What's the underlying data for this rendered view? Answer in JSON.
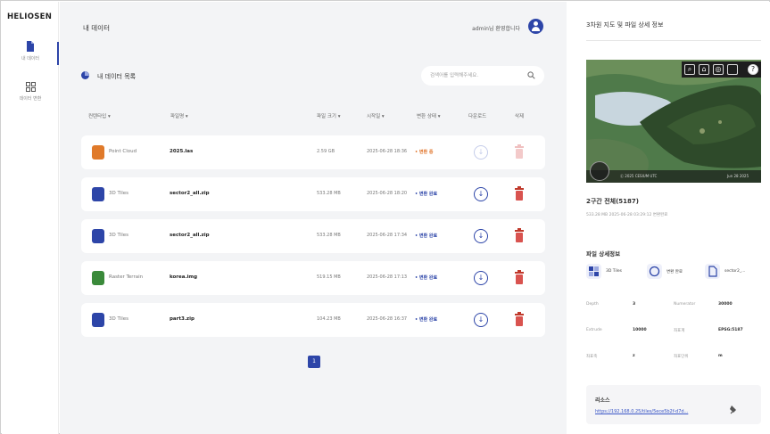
{
  "app": {
    "logo": "HELIOSEN",
    "accent_color": "#2d45a8"
  },
  "sidebar": {
    "items": [
      {
        "label": "내 데이터",
        "icon": "document-icon",
        "active": true
      },
      {
        "label": "데이터 변환",
        "icon": "grid-icon",
        "active": false
      }
    ]
  },
  "header": {
    "title": "내 데이터",
    "greeting": "admin님 환영합니다"
  },
  "list": {
    "title": "내 데이터 목록",
    "search_placeholder": "검색어를 입력해주세요.",
    "columns": [
      "컨텐타입 ▾",
      "파일명 ▾",
      "파일 크기 ▾",
      "시작일 ▾",
      "변환 상태 ▾",
      "다운로드",
      "삭제"
    ],
    "rows": [
      {
        "type": "Point Cloud",
        "type_color": "#e07a2a",
        "name": "2025.las",
        "size": "2.59 GB",
        "date": "2025-06-28 18:36",
        "status": "• 변환 중",
        "status_color": "#e0742a",
        "download_enabled": false
      },
      {
        "type": "3D Tiles",
        "type_color": "#2d45a8",
        "name": "sector2_all.zip",
        "size": "533.28 MB",
        "date": "2025-06-28 18:20",
        "status": "• 변환 완료",
        "status_color": "#2d45a8",
        "download_enabled": true
      },
      {
        "type": "3D Tiles",
        "type_color": "#2d45a8",
        "name": "sector2_all.zip",
        "size": "533.28 MB",
        "date": "2025-06-28 17:34",
        "status": "• 변환 완료",
        "status_color": "#2d45a8",
        "download_enabled": true
      },
      {
        "type": "Raster Terrain",
        "type_color": "#3a8a3a",
        "name": "korea.img",
        "size": "519.15 MB",
        "date": "2025-06-28 17:13",
        "status": "• 변환 완료",
        "status_color": "#2d45a8",
        "download_enabled": true
      },
      {
        "type": "3D Tiles",
        "type_color": "#2d45a8",
        "name": "part3.zip",
        "size": "104.23 MB",
        "date": "2025-06-28 16:37",
        "status": "• 변환 완료",
        "status_color": "#2d45a8",
        "download_enabled": true
      }
    ],
    "page": "1"
  },
  "panel": {
    "title": "3차원 지도 및 파일 상세 정보",
    "map": {
      "controls": [
        "search-icon",
        "home-icon",
        "globe-icon",
        "layers-icon",
        "help-icon"
      ],
      "footer_left": "Ⓒ 2025 CESIUM UTC",
      "footer_date": "Jun 28 2025"
    },
    "file_name": "2구간 전체(5187)",
    "file_meta": "533.28 MB   2025-06-28 03:29:12 변환완료",
    "detail_title": "파일 상세정보",
    "chips": [
      {
        "label": "3D Tiles",
        "icon": "tiles-icon"
      },
      {
        "label": "변환 완료",
        "icon": "circle-icon"
      },
      {
        "label": "sector2_...",
        "icon": "file-icon"
      }
    ],
    "fields": [
      {
        "k1": "Depth",
        "v1": "3",
        "k2": "Numerator",
        "v2": "30000"
      },
      {
        "k1": "Extrude",
        "v1": "10000",
        "k2": "좌표계",
        "v2": "EPSG:5187"
      },
      {
        "k1": "좌표축",
        "v1": "z",
        "k2": "좌표단위",
        "v2": "m"
      }
    ],
    "resource_label": "리소스",
    "resource_url": "https://192.168.0.25/tiles/5ece5b2f-d7d..."
  }
}
